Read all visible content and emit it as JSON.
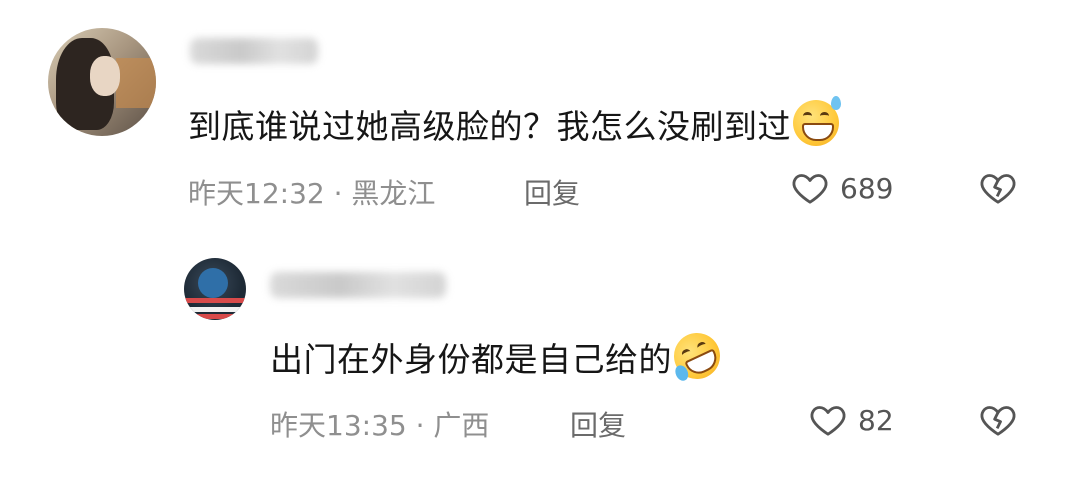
{
  "comments": [
    {
      "text": "到底谁说过她高级脸的？我怎么没刷到过",
      "emoji": "grinning-sweat-emoji",
      "meta": "昨天12:32 · 黑龙江",
      "reply_label": "回复",
      "like_count": "689"
    },
    {
      "text": "出门在外身份都是自己给的",
      "emoji": "rolling-on-floor-laughing-emoji",
      "meta": "昨天13:35 · 广西",
      "reply_label": "回复",
      "like_count": "82"
    }
  ],
  "colors": {
    "text": "#161616",
    "meta": "#8f8f8f",
    "icon": "#555555"
  }
}
